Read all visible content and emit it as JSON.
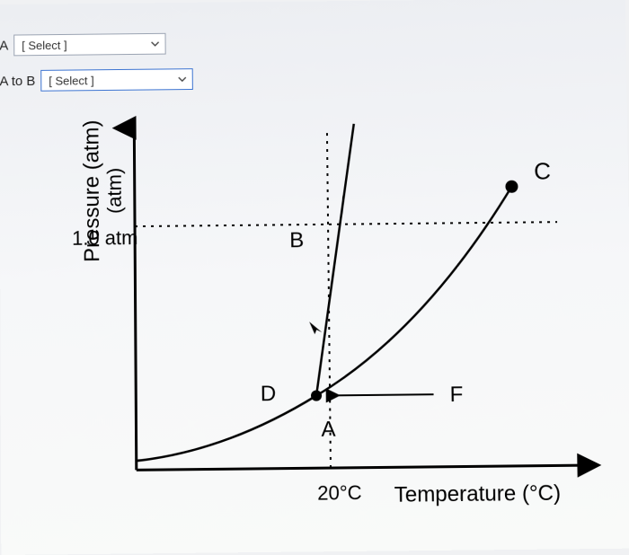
{
  "controls": {
    "rowA": {
      "label": "A",
      "placeholder": "[ Select ]"
    },
    "rowAB": {
      "label": "A to B",
      "placeholder": "[ Select ]"
    }
  },
  "chart_data": {
    "type": "line",
    "title": "",
    "xlabel": "Temperature (°C)",
    "ylabel": "Pressure (atm)",
    "y_secondary_label": "(atm)",
    "y_tick_label": "1.0 atm",
    "x_tick_label": "20°C",
    "points": {
      "A": {
        "label": "A"
      },
      "B": {
        "label": "B"
      },
      "C": {
        "label": "C"
      },
      "D": {
        "label": "D"
      },
      "F": {
        "label": "F"
      }
    },
    "triple_point_approx": {
      "temperature_c": 20,
      "pressure_atm": 0.3
    },
    "reference_lines": {
      "pressure_atm": 1.0,
      "temperature_c": 20
    }
  }
}
